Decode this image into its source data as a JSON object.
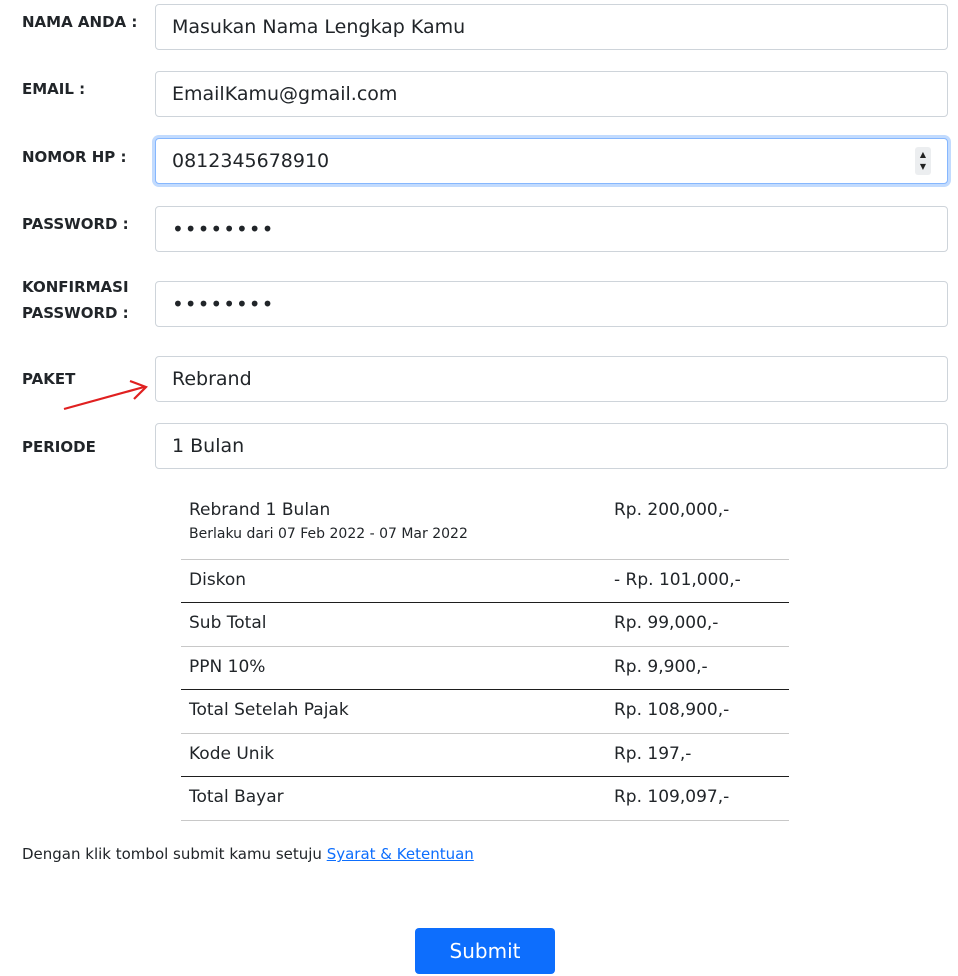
{
  "form": {
    "name_label": "NAMA ANDA :",
    "name_value": "Masukan Nama Lengkap Kamu",
    "email_label": "EMAIL :",
    "email_value": "EmailKamu@gmail.com",
    "phone_label": "NOMOR HP :",
    "phone_value": "0812345678910",
    "password_label": "PASSWORD :",
    "password_value": "••••••••",
    "confirm_label_line1": "KONFIRMASI",
    "confirm_label_line2": "PASSWORD :",
    "confirm_value": "••••••••",
    "package_label": "PAKET",
    "package_value": "Rebrand",
    "period_label": "PERIODE",
    "period_value": "1 Bulan"
  },
  "summary": {
    "item_name": "Rebrand 1 Bulan",
    "item_price": "Rp. 200,000,-",
    "validity": "Berlaku dari 07 Feb 2022 - 07 Mar 2022",
    "rows": [
      {
        "name": "Diskon",
        "amount": "- Rp. 101,000,-"
      },
      {
        "name": "Sub Total",
        "amount": "Rp. 99,000,-"
      },
      {
        "name": "PPN 10%",
        "amount": "Rp. 9,900,-"
      },
      {
        "name": "Total Setelah Pajak",
        "amount": "Rp. 108,900,-"
      },
      {
        "name": "Kode Unik",
        "amount": "Rp. 197,-"
      },
      {
        "name": "Total Bayar",
        "amount": "Rp. 109,097,-"
      }
    ]
  },
  "terms": {
    "text": "Dengan klik tombol submit kamu setuju ",
    "link": "Syarat & Ketentuan"
  },
  "submit_label": "Submit",
  "colors": {
    "accent": "#0d6efd",
    "arrow": "#e02020"
  }
}
